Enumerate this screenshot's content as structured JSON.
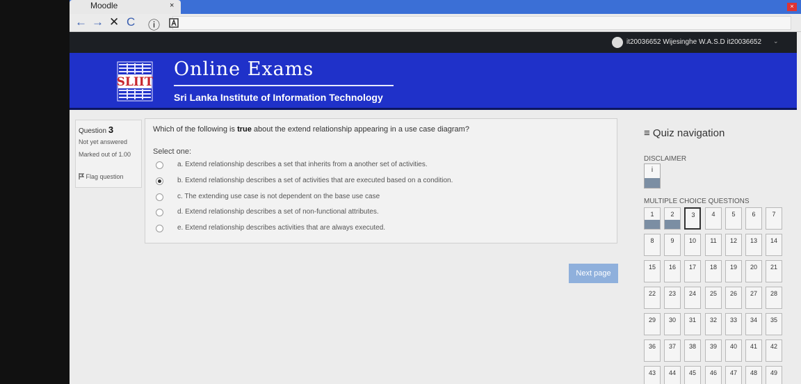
{
  "browser": {
    "tab_title": "Moodle",
    "tab_close": "×",
    "window_close": "×",
    "nav": {
      "back": "←",
      "forward": "→",
      "stop": "✕",
      "reload": "C",
      "info": "ⓘ"
    }
  },
  "topbar": {
    "user": "it20036652 Wijesinghe W.A.S.D it20036652",
    "caret": "⌄"
  },
  "header": {
    "logo_text": "SLIIT",
    "title": "Online Exams",
    "subtitle": "Sri Lanka Institute of Information Technology"
  },
  "question_info": {
    "label": "Question",
    "number": "3",
    "status": "Not yet answered",
    "marks": "Marked out of 1.00",
    "flag": "Flag question"
  },
  "question": {
    "text_before": "Which of the following is ",
    "text_emph": "true",
    "text_after": " about the extend relationship appearing in a use case diagram?",
    "select_one": "Select one:",
    "options": [
      {
        "label": "a. Extend relationship describes a set that inherits from a another set of activities.",
        "selected": false
      },
      {
        "label": "b. Extend relationship describes a set of activities that are executed based on a condition.",
        "selected": true
      },
      {
        "label": "c. The extending use case is not dependent on the base use case",
        "selected": false
      },
      {
        "label": "d. Extend relationship describes a set of non-functional attributes.",
        "selected": false
      },
      {
        "label": "e. Extend relationship describes activities that are always executed.",
        "selected": false
      }
    ]
  },
  "next_button": "Next page",
  "quiz_nav": {
    "title": "≡ Quiz navigation",
    "disclaimer_label": "DISCLAIMER",
    "disclaimer_item": "i",
    "mcq_label": "MULTIPLE CHOICE QUESTIONS",
    "current": 3,
    "answered": [
      1,
      2
    ],
    "questions": [
      "1",
      "2",
      "3",
      "4",
      "5",
      "6",
      "7",
      "8",
      "9",
      "10",
      "11",
      "12",
      "13",
      "14",
      "15",
      "16",
      "17",
      "18",
      "19",
      "20",
      "21",
      "22",
      "23",
      "24",
      "25",
      "26",
      "27",
      "28",
      "29",
      "30",
      "31",
      "32",
      "33",
      "34",
      "35",
      "36",
      "37",
      "38",
      "39",
      "40",
      "41",
      "42",
      "43",
      "44",
      "45",
      "46",
      "47",
      "48",
      "49"
    ]
  },
  "colors": {
    "header_bg": "#1f31c9",
    "topbar_bg": "#1c1f24",
    "answered_fill": "#7b8ea3",
    "next_btn": "#8fb0dc"
  }
}
